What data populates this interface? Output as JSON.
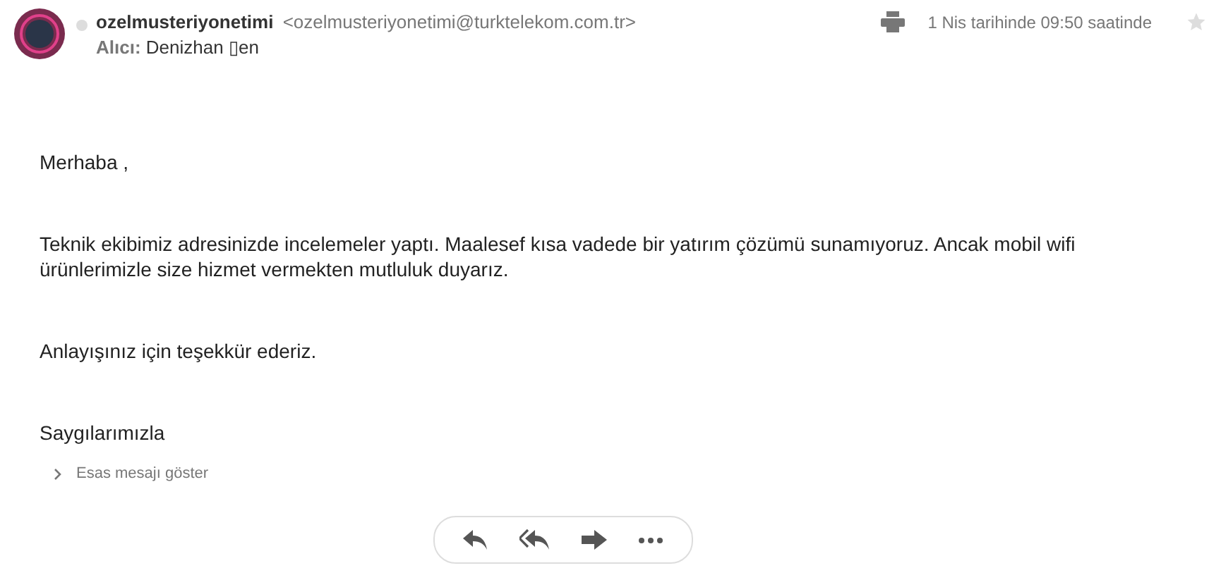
{
  "header": {
    "sender_name": "ozelmusteriyonetimi",
    "sender_email": "<ozelmusteriyonetimi@turktelekom.com.tr>",
    "recipient_label": "Alıcı:",
    "recipient": "Denizhan ▯en",
    "date": "1 Nis tarihinde 09:50 saatinde",
    "starred": false
  },
  "body": [
    "Merhaba ,",
    "Teknik ekibimiz adresinizde incelemeler yaptı. Maalesef kısa vadede bir yatırım çözümü sunamıyoruz. Ancak mobil wifi ürünlerimizle size hizmet vermekten mutluluk duyarız.",
    "Anlayışınız için teşekkür ederiz.",
    "Saygılarımızla"
  ],
  "show_original": "Esas mesajı göster",
  "actions": [
    {
      "kind": "reply"
    },
    {
      "kind": "reply-all"
    },
    {
      "kind": "forward"
    },
    {
      "kind": "more"
    }
  ]
}
